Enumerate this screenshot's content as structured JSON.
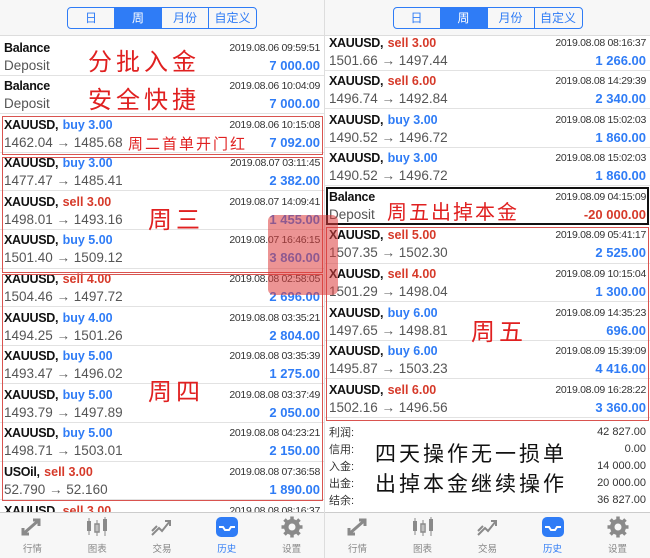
{
  "segments": [
    "日",
    "周",
    "月份",
    "自定义"
  ],
  "active_segment": 1,
  "left_rows": [
    {
      "type": "balance",
      "title": "Balance",
      "sub": "Deposit",
      "time": "2019.08.06 09:59:51",
      "profit": "7 000.00",
      "neg": false
    },
    {
      "type": "balance",
      "title": "Balance",
      "sub": "Deposit",
      "time": "2019.08.06 10:04:09",
      "profit": "7 000.00",
      "neg": false
    },
    {
      "type": "trade",
      "symbol": "XAUUSD,",
      "action": "buy 3.00",
      "side": "buy",
      "time": "2019.08.06 10:15:08",
      "prices": "1462.04 → 1485.68",
      "profit": "7 092.00"
    },
    {
      "type": "trade",
      "symbol": "XAUUSD,",
      "action": "buy 3.00",
      "side": "buy",
      "time": "2019.08.07 03:11:45",
      "prices": "1477.47 → 1485.41",
      "profit": "2 382.00"
    },
    {
      "type": "trade",
      "symbol": "XAUUSD,",
      "action": "sell 3.00",
      "side": "sell",
      "time": "2019.08.07 14:09:41",
      "prices": "1498.01 → 1493.16",
      "profit": "1 455.00"
    },
    {
      "type": "trade",
      "symbol": "XAUUSD,",
      "action": "buy 5.00",
      "side": "buy",
      "time": "2019.08.07 16:46:15",
      "prices": "1501.40 → 1509.12",
      "profit": "3 860.00"
    },
    {
      "type": "trade",
      "symbol": "XAUUSD,",
      "action": "sell 4.00",
      "side": "sell",
      "time": "2019.08.08 02:58:05",
      "prices": "1504.46 → 1497.72",
      "profit": "2 696.00"
    },
    {
      "type": "trade",
      "symbol": "XAUUSD,",
      "action": "buy 4.00",
      "side": "buy",
      "time": "2019.08.08 03:35:21",
      "prices": "1494.25 → 1501.26",
      "profit": "2 804.00"
    },
    {
      "type": "trade",
      "symbol": "XAUUSD,",
      "action": "buy 5.00",
      "side": "buy",
      "time": "2019.08.08 03:35:39",
      "prices": "1493.47 → 1496.02",
      "profit": "1 275.00"
    },
    {
      "type": "trade",
      "symbol": "XAUUSD,",
      "action": "buy 5.00",
      "side": "buy",
      "time": "2019.08.08 03:37:49",
      "prices": "1493.79 → 1497.89",
      "profit": "2 050.00"
    },
    {
      "type": "trade",
      "symbol": "XAUUSD,",
      "action": "buy 5.00",
      "side": "buy",
      "time": "2019.08.08 04:23:21",
      "prices": "1498.71 → 1503.01",
      "profit": "2 150.00"
    },
    {
      "type": "trade",
      "symbol": "USOil,",
      "action": "sell 3.00",
      "side": "sell",
      "time": "2019.08.08 07:36:58",
      "prices": "52.790 → 52.160",
      "profit": "1 890.00"
    },
    {
      "type": "trade",
      "symbol": "XAUUSD,",
      "action": "sell 3.00",
      "side": "sell",
      "time": "2019.08.08 08:16:37",
      "prices": "",
      "profit": ""
    }
  ],
  "right_rows": [
    {
      "type": "trade",
      "symbol": "XAUUSD,",
      "action": "sell 3.00",
      "side": "sell",
      "time": "2019.08.08 08:16:37",
      "prices": "1501.66 → 1497.44",
      "profit": "1 266.00"
    },
    {
      "type": "trade",
      "symbol": "XAUUSD,",
      "action": "sell 6.00",
      "side": "sell",
      "time": "2019.08.08 14:29:39",
      "prices": "1496.74 → 1492.84",
      "profit": "2 340.00"
    },
    {
      "type": "trade",
      "symbol": "XAUUSD,",
      "action": "buy 3.00",
      "side": "buy",
      "time": "2019.08.08 15:02:03",
      "prices": "1490.52 → 1496.72",
      "profit": "1 860.00"
    },
    {
      "type": "trade",
      "symbol": "XAUUSD,",
      "action": "buy 3.00",
      "side": "buy",
      "time": "2019.08.08 15:02:03",
      "prices": "1490.52 → 1496.72",
      "profit": "1 860.00"
    },
    {
      "type": "balance",
      "title": "Balance",
      "sub": "Deposit",
      "time": "2019.08.09 04:15:09",
      "profit": "-20 000.00",
      "neg": true
    },
    {
      "type": "trade",
      "symbol": "XAUUSD,",
      "action": "sell 5.00",
      "side": "sell",
      "time": "2019.08.09 05:41:17",
      "prices": "1507.35 → 1502.30",
      "profit": "2 525.00"
    },
    {
      "type": "trade",
      "symbol": "XAUUSD,",
      "action": "sell 4.00",
      "side": "sell",
      "time": "2019.08.09 10:15:04",
      "prices": "1501.29 → 1498.04",
      "profit": "1 300.00"
    },
    {
      "type": "trade",
      "symbol": "XAUUSD,",
      "action": "buy 6.00",
      "side": "buy",
      "time": "2019.08.09 14:35:23",
      "prices": "1497.65 → 1498.81",
      "profit": "696.00"
    },
    {
      "type": "trade",
      "symbol": "XAUUSD,",
      "action": "buy 6.00",
      "side": "buy",
      "time": "2019.08.09 15:39:09",
      "prices": "1495.87 → 1503.23",
      "profit": "4 416.00"
    },
    {
      "type": "trade",
      "symbol": "XAUUSD,",
      "action": "sell 6.00",
      "side": "sell",
      "time": "2019.08.09 16:28:22",
      "prices": "1502.16 → 1496.56",
      "profit": "3 360.00"
    }
  ],
  "summary": [
    {
      "label": "利润:",
      "value": "42 827.00"
    },
    {
      "label": "信用:",
      "value": "0.00"
    },
    {
      "label": "入金:",
      "value": "14 000.00"
    },
    {
      "label": "出金:",
      "value": "20 000.00"
    },
    {
      "label": "结余:",
      "value": "36 827.00"
    }
  ],
  "annotations": {
    "deposit_1": "分批入金",
    "deposit_2": "安全快捷",
    "tuesday": "周二首单开门红",
    "wednesday": "周三",
    "thursday": "周四",
    "friday_withdraw": "周五出掉本金",
    "friday": "周五",
    "summary_1": "四天操作无一损单",
    "summary_2": "出掉本金继续操作"
  },
  "tabs": [
    {
      "label": "行情",
      "icon": "quotes-icon"
    },
    {
      "label": "图表",
      "icon": "chart-icon"
    },
    {
      "label": "交易",
      "icon": "trade-icon"
    },
    {
      "label": "历史",
      "icon": "history-icon"
    },
    {
      "label": "设置",
      "icon": "settings-icon"
    }
  ],
  "active_tab": 3,
  "colors": {
    "accent": "#2f7cf6",
    "sell": "#d63a2a",
    "annotation": "#e02020"
  }
}
